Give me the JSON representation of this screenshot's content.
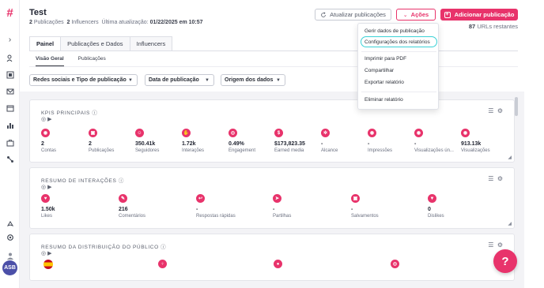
{
  "header": {
    "title": "Test",
    "pub_count": "2",
    "pub_label": "Publicações",
    "inf_count": "2",
    "inf_label": "Influencers",
    "updated_label": "Última atualização:",
    "updated_value": "01/22/2025 em 10:57"
  },
  "buttons": {
    "refresh": "Atualizar publicações",
    "actions": "Ações",
    "add": "Adicionar publicação"
  },
  "urls": {
    "count": "87",
    "label": "URLs restantes"
  },
  "tabs": [
    {
      "label": "Painel"
    },
    {
      "label": "Publicações e Dados"
    },
    {
      "label": "Influencers"
    }
  ],
  "subtabs": [
    {
      "label": "Visão Geral"
    },
    {
      "label": "Publicações"
    }
  ],
  "filters": [
    {
      "label": "Redes sociais e Tipo de publicação"
    },
    {
      "label": "Data de publicação"
    },
    {
      "label": "Origem dos dados"
    }
  ],
  "actions_menu": [
    {
      "label": "Gerir dados de publicação"
    },
    {
      "label": "Configurações dos relatórios"
    },
    {
      "label": "Imprimir para PDF"
    },
    {
      "label": "Compartilhar"
    },
    {
      "label": "Exportar relatório"
    },
    {
      "label": "Eliminar relatório"
    }
  ],
  "kpis": {
    "title": "KPIS PRINCIPAIS",
    "items": [
      {
        "value": "2",
        "label": "Contas"
      },
      {
        "value": "2",
        "label": "Publicações"
      },
      {
        "value": "350.41k",
        "label": "Seguidores"
      },
      {
        "value": "1.72k",
        "label": "Interações"
      },
      {
        "value": "0.49%",
        "label": "Engagement"
      },
      {
        "value": "$173,823.35",
        "label": "Earned media"
      },
      {
        "value": "-",
        "label": "Alcance"
      },
      {
        "value": "-",
        "label": "Impressões"
      },
      {
        "value": "-",
        "label": "Visualizações ún..."
      },
      {
        "value": "913.13k",
        "label": "Visualizações"
      }
    ]
  },
  "interactions": {
    "title": "RESUMO DE INTERAÇÕES",
    "items": [
      {
        "value": "1.50k",
        "label": "Likes"
      },
      {
        "value": "216",
        "label": "Comentários"
      },
      {
        "value": "-",
        "label": "Respostas rápidas"
      },
      {
        "value": "-",
        "label": "Partilhas"
      },
      {
        "value": "-",
        "label": "Salvamentos"
      },
      {
        "value": "0",
        "label": "Dislikes"
      }
    ]
  },
  "audience": {
    "title": "RESUMO DA DISTRIBUIÇÃO DO PÚBLICO"
  },
  "user": {
    "initials": "ASB"
  },
  "colors": {
    "accent": "#e8336b",
    "highlight": "#3ad1d6"
  }
}
